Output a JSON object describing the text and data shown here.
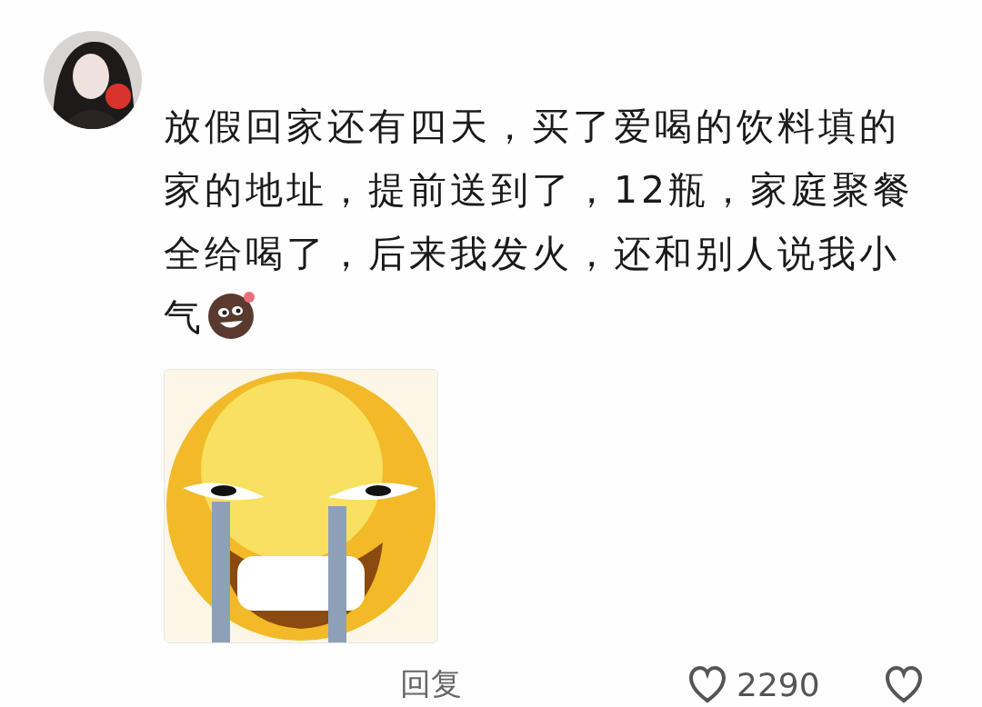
{
  "comment": {
    "text": "放假回家还有四天，买了爱喝的饮料填的家的地址，提前送到了，12瓶，家庭聚餐全给喝了，后来我发火，还和别人说我小气"
  },
  "actions": {
    "reply": "回复",
    "like_count": "2290"
  }
}
